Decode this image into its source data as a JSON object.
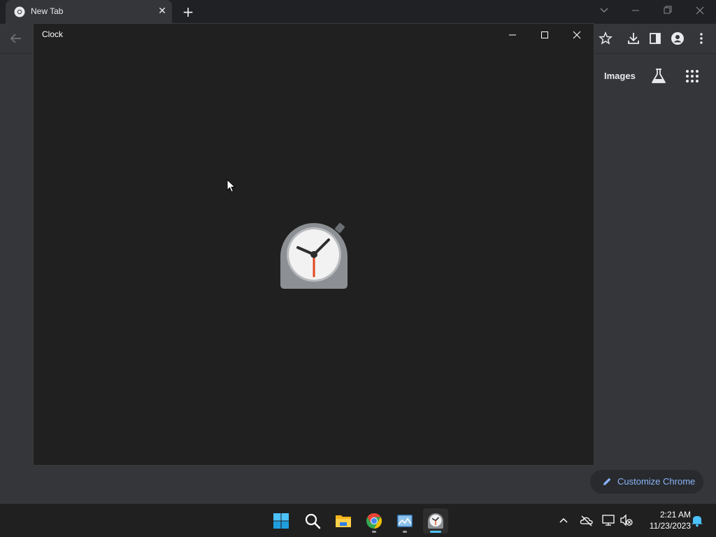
{
  "browser": {
    "tab_title": "New Tab",
    "ntp": {
      "images_link": "Images",
      "customize_button": "Customize Chrome"
    }
  },
  "clock_window": {
    "title": "Clock",
    "splash_icon": "stopwatch-clock-icon"
  },
  "taskbar": {
    "apps": [
      "start-icon",
      "search-icon",
      "file-explorer-icon",
      "chrome-icon",
      "photos-icon",
      "clock-app-icon"
    ],
    "time": "2:21 AM",
    "date": "11/23/2023"
  },
  "colors": {
    "accent": "#4cc2ff",
    "link": "#8ab4f8"
  }
}
